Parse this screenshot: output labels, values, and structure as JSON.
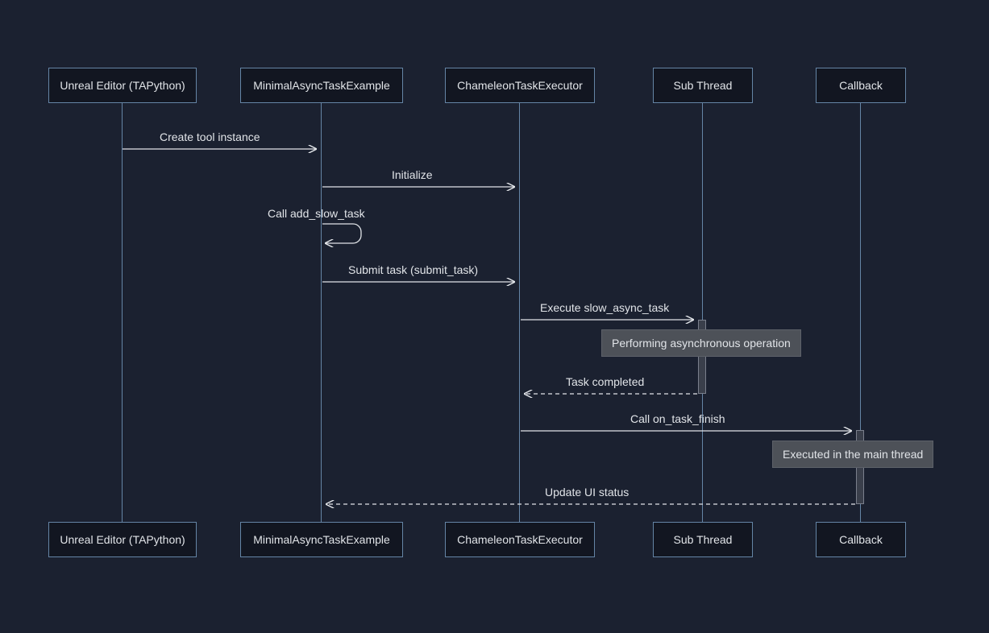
{
  "participants": {
    "p1": "Unreal Editor (TAPython)",
    "p2": "MinimalAsyncTaskExample",
    "p3": "ChameleonTaskExecutor",
    "p4": "Sub Thread",
    "p5": "Callback"
  },
  "messages": {
    "m1": "Create tool instance",
    "m2": "Initialize",
    "m3": "Call add_slow_task",
    "m4": "Submit task (submit_task)",
    "m5": "Execute slow_async_task",
    "m6": "Task completed",
    "m7": "Call on_task_finish",
    "m8": "Update UI status"
  },
  "notes": {
    "n1": "Performing asynchronous operation",
    "n2": "Executed in the main thread"
  }
}
